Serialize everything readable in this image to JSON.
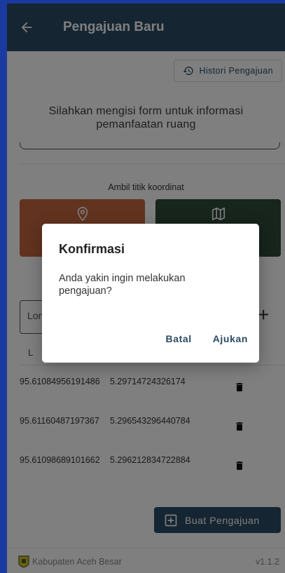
{
  "appbar": {
    "title": "Pengajuan Baru",
    "back_icon": "arrow-left-icon"
  },
  "history_button": {
    "label": "Histori Pengajuan",
    "icon": "history-icon"
  },
  "intro": {
    "text": "Silahkan mengisi form untuk informasi pemanfaatan ruang"
  },
  "coordinate_section": {
    "label": "Ambil titik koordinat",
    "location_icon": "map-pin-icon",
    "map_icon": "map-icon"
  },
  "longitude_input": {
    "placeholder": "Lon"
  },
  "add_icon": "+",
  "table": {
    "col_left_header": "L",
    "rows": [
      {
        "lon": "95.61084956191486",
        "lat": "5.29714724326174"
      },
      {
        "lon": "95.61160487197367",
        "lat": "5.296543296440784"
      },
      {
        "lon": "95.61098689101662",
        "lat": "5.296212834722884"
      }
    ]
  },
  "submit_button": {
    "label": "Buat Pengajuan",
    "icon": "add-box-icon"
  },
  "footer": {
    "org": "Kabupaten Aceh Besar",
    "version": "v1.1.2"
  },
  "dialog": {
    "title": "Konfirmasi",
    "message": "Anda yakin ingin melakukan pengajuan?",
    "cancel_label": "Batal",
    "confirm_label": "Ajukan"
  },
  "colors": {
    "appbar": "#2c4a64",
    "location_button": "#c4663e",
    "map_button": "#2e4a38",
    "scrim": "rgba(0,0,0,0.5)"
  }
}
